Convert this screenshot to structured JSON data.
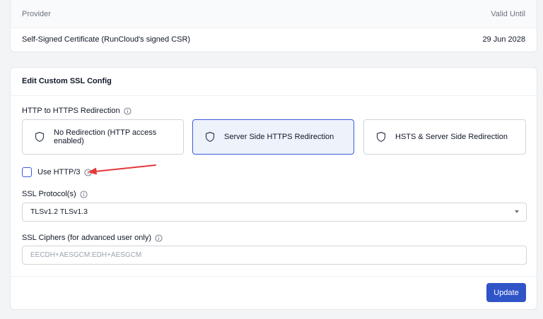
{
  "certificate_table": {
    "headers": {
      "provider": "Provider",
      "valid_until": "Valid Until"
    },
    "rows": [
      {
        "provider": "Self-Signed Certificate (RunCloud's signed CSR)",
        "valid_until": "29 Jun 2028"
      }
    ]
  },
  "ssl_config": {
    "title": "Edit Custom SSL Config",
    "redirection": {
      "label": "HTTP to HTTPS Redirection",
      "options": [
        {
          "label": "No Redirection (HTTP access enabled)",
          "selected": false
        },
        {
          "label": "Server Side HTTPS Redirection",
          "selected": true
        },
        {
          "label": "HSTS & Server Side Redirection",
          "selected": false
        }
      ]
    },
    "http3": {
      "label": "Use HTTP/3",
      "checked": false
    },
    "protocols": {
      "label": "SSL Protocol(s)",
      "value": "TLSv1.2 TLSv1.3"
    },
    "ciphers": {
      "label": "SSL Ciphers (for advanced user only)",
      "value": "",
      "placeholder": "EECDH+AESGCM:EDH+AESGCM"
    },
    "update_button": "Update"
  },
  "icons": {
    "info": "info-icon",
    "shield": "shield-icon",
    "caret": "chevron-down-icon"
  },
  "colors": {
    "accent": "#2f54c7",
    "selected_bg": "#eef2fb",
    "annotation": "#e5383b"
  }
}
